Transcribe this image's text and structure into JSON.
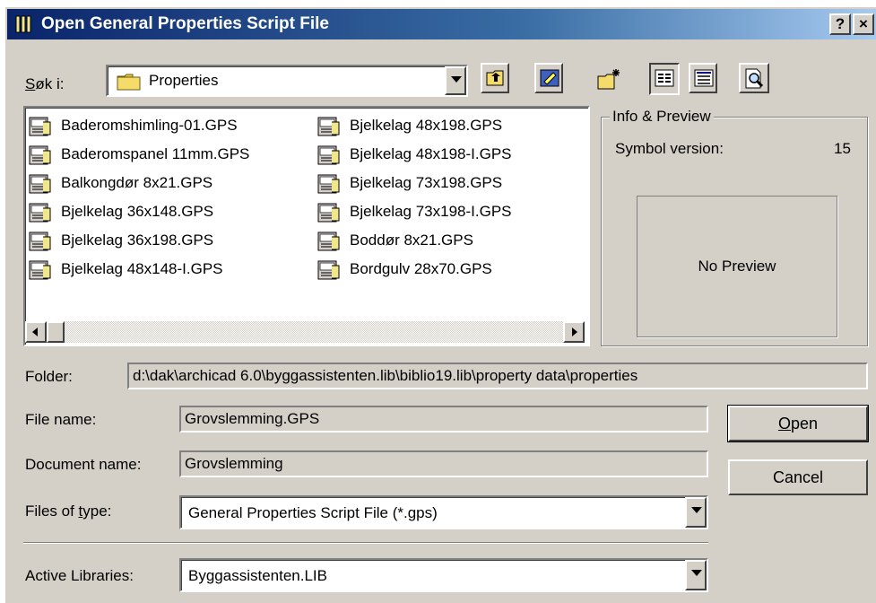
{
  "window": {
    "title": "Open General Properties Script File",
    "help_label": "?",
    "close_label": "×"
  },
  "look_in": {
    "label": "Søk i:",
    "value": "Properties"
  },
  "toolbar": {
    "icons": [
      "up-one-level-icon",
      "desktop-icon",
      "new-folder-icon",
      "list-view-icon",
      "details-view-icon",
      "preview-icon"
    ]
  },
  "files": {
    "column1": [
      "Baderomshimling-01.GPS",
      "Baderomspanel 11mm.GPS",
      "Balkongdør 8x21.GPS",
      "Bjelkelag 36x148.GPS",
      "Bjelkelag 36x198.GPS",
      "Bjelkelag 48x148-I.GPS"
    ],
    "column2": [
      "Bjelkelag 48x198.GPS",
      "Bjelkelag 48x198-I.GPS",
      "Bjelkelag 73x198.GPS",
      "Bjelkelag 73x198-I.GPS",
      "Boddør 8x21.GPS",
      "Bordgulv 28x70.GPS"
    ]
  },
  "info": {
    "title": "Info & Preview",
    "symbol_label": "Symbol version:",
    "symbol_value": "15",
    "preview_text": "No Preview"
  },
  "folder": {
    "label": "Folder:",
    "path": "d:\\dak\\archicad 6.0\\byggassistenten.lib\\biblio19.lib\\property data\\properties"
  },
  "file_name": {
    "label": "File name:",
    "value": "Grovslemming.GPS"
  },
  "document_name": {
    "label": "Document name:",
    "value": "Grovslemming"
  },
  "files_of_type": {
    "label_pre": "Files of ",
    "label_u": "t",
    "label_post": "ype:",
    "value": "General Properties Script File (*.gps)"
  },
  "active_libraries": {
    "label": "Active Libraries:",
    "value": "Byggassistenten.LIB"
  },
  "buttons": {
    "open_u": "O",
    "open_rest": "pen",
    "cancel": "Cancel"
  }
}
